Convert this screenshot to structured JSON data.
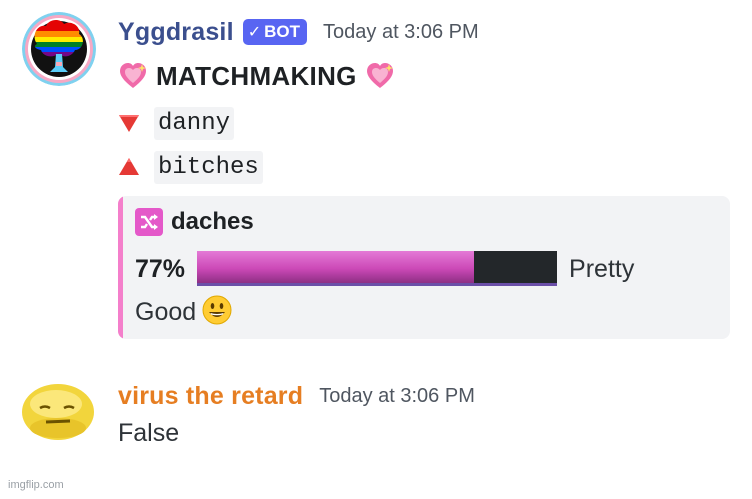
{
  "messages": [
    {
      "author": "Yggdrasil",
      "author_color": "#3b4f8e",
      "badge": {
        "check": "✓",
        "label": "BOT"
      },
      "timestamp": "Today at 3:06 PM",
      "title": "MATCHMAKING",
      "lines": [
        {
          "icon": "red-down-triangle-icon",
          "text": "danny"
        },
        {
          "icon": "red-up-triangle-icon",
          "text": "bitches"
        }
      ],
      "embed": {
        "accent": "#f47fcb",
        "icon": "shuffle-icon",
        "title": "daches",
        "percent_label": "77%",
        "percent_value": 0.77,
        "rating_line1": "Pretty",
        "rating_line2": "Good",
        "rating_emoji": "grinning-face-icon"
      }
    },
    {
      "author": "virus the retard",
      "author_color": "#e67e22",
      "timestamp": "Today at 3:06 PM",
      "content": "False"
    }
  ],
  "watermark": "imgflip.com"
}
